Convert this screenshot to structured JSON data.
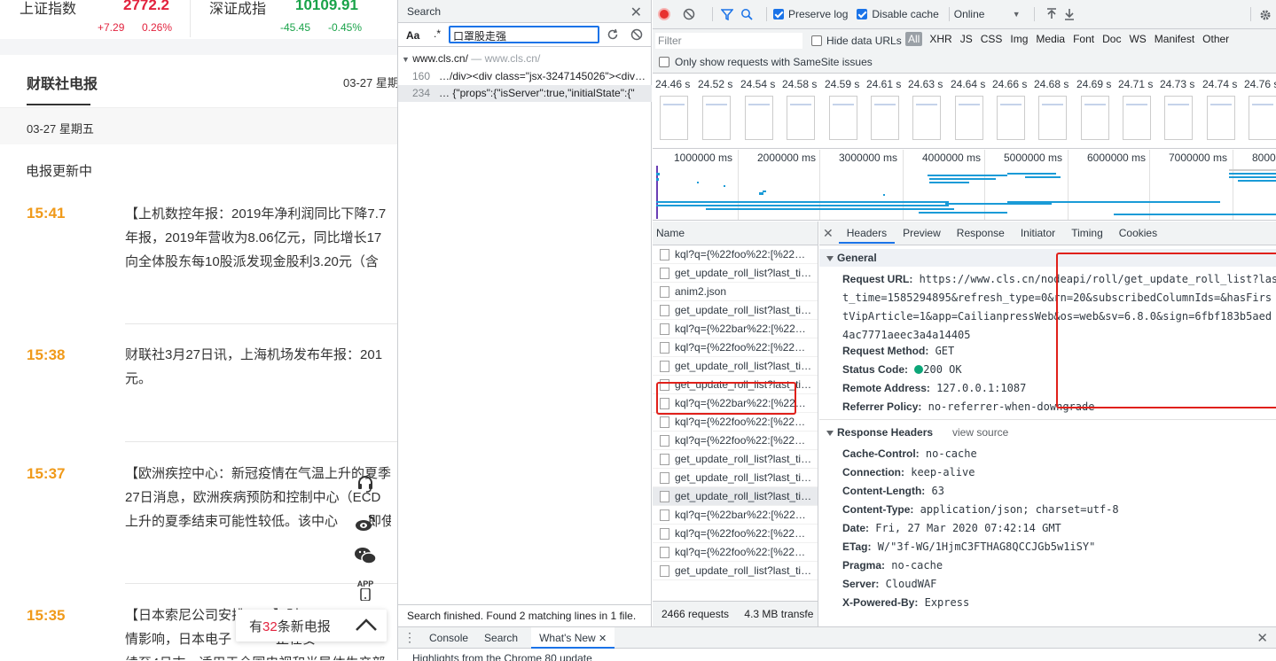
{
  "left": {
    "market": [
      {
        "name": "上证指数",
        "value": "2772.2",
        "change": "+7.29",
        "pct": "0.26%",
        "dir": "up"
      },
      {
        "name": "深证成指",
        "value": "10109.91",
        "change": "-45.45",
        "pct": "-0.45%",
        "dir": "down"
      }
    ],
    "section_title": "财联社电报",
    "section_date": "03-27 星期",
    "date_bar": "03-27 星期五",
    "updating": "电报更新中",
    "news": [
      {
        "time": "15:41",
        "lines": [
          "【上机数控年报：2019年净利润同比下降7.7",
          "年报，2019年营收为8.06亿元，同比增长17",
          "向全体股东每10股派发现金股利3.20元（含"
        ]
      },
      {
        "time": "15:38",
        "lines": [
          "财联社3月27日讯，上海机场发布年报：201",
          "元。"
        ]
      },
      {
        "time": "15:37",
        "lines": [
          "【欧洲疾控中心：新冠疫情在气温上升的夏季",
          "27日消息，欧洲疾病预防和控制中心（ECD",
          "上升的夏季结束可能性较低。该中心",
          "即使"
        ]
      },
      {
        "time": "15:35",
        "lines": [
          "【日本索尼公司安排",
          "】财",
          "情影响，日本电子",
          "正在安",
          "续至4月末，适用于全国电视和半导体生产部"
        ]
      }
    ],
    "new_count_prefix": "有",
    "new_count": "32",
    "new_count_suffix": "条新电报",
    "app_label": "APP"
  },
  "search": {
    "title": "Search",
    "aa": "Aa",
    "regex": ".*",
    "query": "口罩股走强",
    "domain": "www.cls.cn/",
    "domain_dim": "— www.cls.cn/",
    "results": [
      {
        "line": "160",
        "text": "…/div><div class=\"jsx-3247145026\"><div…"
      },
      {
        "line": "234",
        "text": "… {\"props\":{\"isServer\":true,\"initialState\":{\""
      }
    ],
    "status": "Search finished.  Found 2 matching lines in 1 file."
  },
  "network": {
    "preserve_log": "Preserve log",
    "disable_cache": "Disable cache",
    "throttle": "Online",
    "filter_placeholder": "Filter",
    "hide_data_urls": "Hide data URLs",
    "types": [
      "All",
      "XHR",
      "JS",
      "CSS",
      "Img",
      "Media",
      "Font",
      "Doc",
      "WS",
      "Manifest",
      "Other"
    ],
    "samesite": "Only show requests with SameSite issues",
    "filmstrip_times": [
      "24.46 s",
      "24.52 s",
      "24.54 s",
      "24.58 s",
      "24.59 s",
      "24.61 s",
      "24.63 s",
      "24.64 s",
      "24.66 s",
      "24.68 s",
      "24.69 s",
      "24.71 s",
      "24.73 s",
      "24.74 s",
      "24.76 s"
    ],
    "ticks": [
      "1000000 ms",
      "2000000 ms",
      "3000000 ms",
      "4000000 ms",
      "5000000 ms",
      "6000000 ms",
      "7000000 ms",
      "8000"
    ],
    "name_header": "Name",
    "requests": [
      "kql?q={%22foo%22:[%22…",
      "get_update_roll_list?last_ti…",
      "anim2.json",
      "get_update_roll_list?last_ti…",
      "kql?q={%22bar%22:[%22…",
      "kql?q={%22foo%22:[%22…",
      "get_update_roll_list?last_ti…",
      "get_update_roll_list?last_ti…",
      "kql?q={%22bar%22:[%22…",
      "kql?q={%22foo%22:[%22…",
      "kql?q={%22foo%22:[%22…",
      "get_update_roll_list?last_ti…",
      "get_update_roll_list?last_ti…",
      "get_update_roll_list?last_ti…",
      "kql?q={%22bar%22:[%22…",
      "kql?q={%22foo%22:[%22…",
      "kql?q={%22foo%22:[%22…",
      "get_update_roll_list?last_ti…"
    ],
    "summary_requests": "2466 requests",
    "summary_transfer": "4.3 MB transfe",
    "detail_tabs": [
      "Headers",
      "Preview",
      "Response",
      "Initiator",
      "Timing",
      "Cookies"
    ],
    "general_title": "General",
    "general": {
      "url_label": "Request URL:",
      "url_lines": [
        "https://www.cls.cn/nodeapi/roll/get_update_roll_list?las",
        "t_time=1585294895&refresh_type=0&rn=20&subscribedColumnIds=&hasFirs",
        "tVipArticle=1&app=CailianpressWeb&os=web&sv=6.8.0&sign=6fbf183b5aed",
        "4ac7771aeec3a4a14405"
      ],
      "method_label": "Request Method:",
      "method": "GET",
      "status_label": "Status Code:",
      "status": "200  OK",
      "remote_label": "Remote Address:",
      "remote": "127.0.0.1:1087",
      "referrer_label": "Referrer Policy:",
      "referrer": "no-referrer-when-downgrade"
    },
    "response_headers_title": "Response Headers",
    "view_source": "view source",
    "response_headers": [
      {
        "k": "Cache-Control:",
        "v": "no-cache"
      },
      {
        "k": "Connection:",
        "v": "keep-alive"
      },
      {
        "k": "Content-Length:",
        "v": "63"
      },
      {
        "k": "Content-Type:",
        "v": "application/json; charset=utf-8"
      },
      {
        "k": "Date:",
        "v": "Fri, 27 Mar 2020 07:42:14 GMT"
      },
      {
        "k": "ETag:",
        "v": "W/\"3f-WG/1HjmC3FTHAG8QCCJGb5w1iSY\""
      },
      {
        "k": "Pragma:",
        "v": "no-cache"
      },
      {
        "k": "Server:",
        "v": "CloudWAF"
      },
      {
        "k": "X-Powered-By:",
        "v": "Express"
      }
    ]
  },
  "drawer": {
    "tabs": [
      "Console",
      "Search",
      "What's New"
    ],
    "whatsnew_text": "Highlights from the Chrome 80 update"
  },
  "colors": {
    "accent": "#1a73e8",
    "record": "#e8312f",
    "highlight": "#e0201a",
    "news_time": "#f09a1a"
  }
}
